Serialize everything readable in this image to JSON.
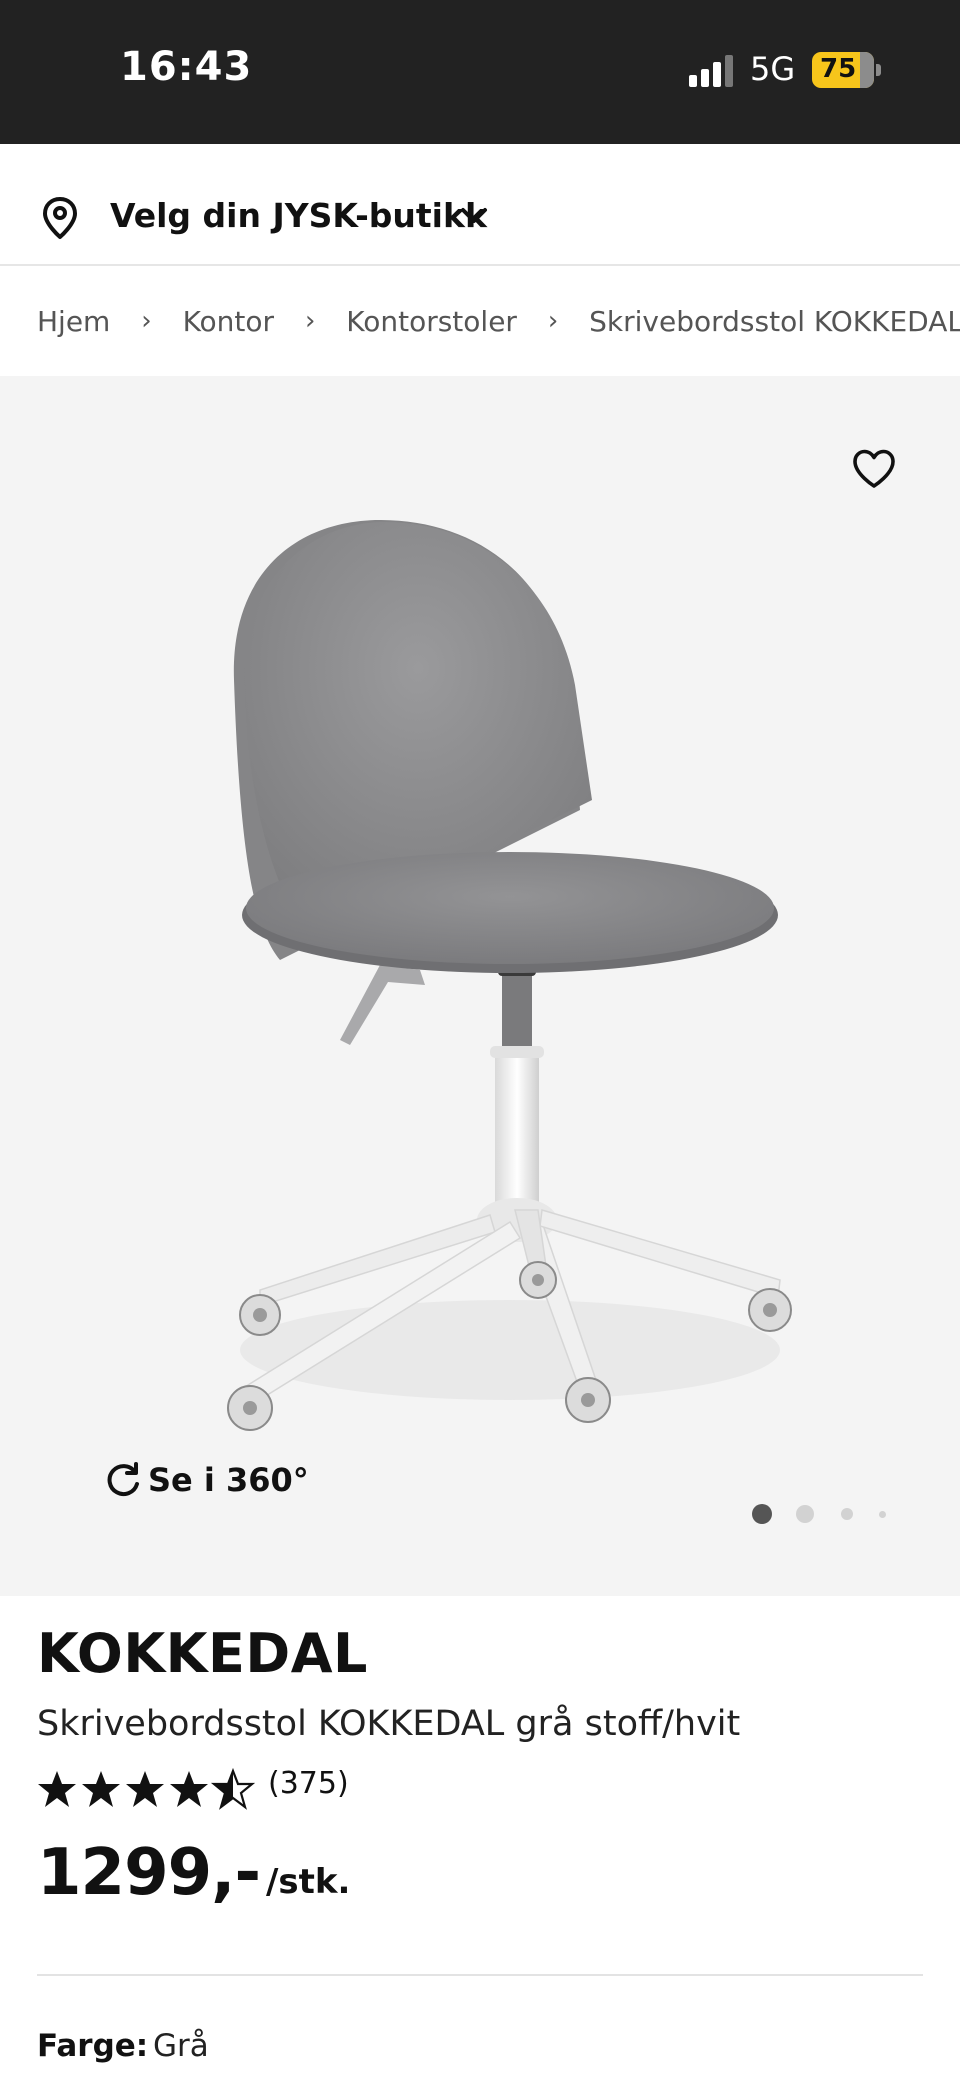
{
  "status_bar": {
    "time": "16:43",
    "network": "5G",
    "battery": "75"
  },
  "store_selector": {
    "label": "Velg din JYSK-butikk",
    "icon": "location-pin-icon"
  },
  "breadcrumb": {
    "items": [
      "Hjem",
      "Kontor",
      "Kontorstoler",
      "Skrivebordsstol KOKKEDAL g"
    ]
  },
  "gallery": {
    "view360_label": "Se i 360°",
    "slide_count": 4,
    "active_slide": 1
  },
  "product": {
    "brand": "KOKKEDAL",
    "name": "Skrivebordsstol KOKKEDAL grå stoff/hvit",
    "rating": 4.5,
    "review_count": "(375)",
    "price": "1299,-",
    "unit": "/stk.",
    "color_label": "Farge:",
    "color_value": "Grå"
  },
  "colors": {
    "status_bar_bg": "#222222",
    "battery": "#f7c51b",
    "gallery_bg": "#f4f4f4",
    "text": "#111111"
  }
}
